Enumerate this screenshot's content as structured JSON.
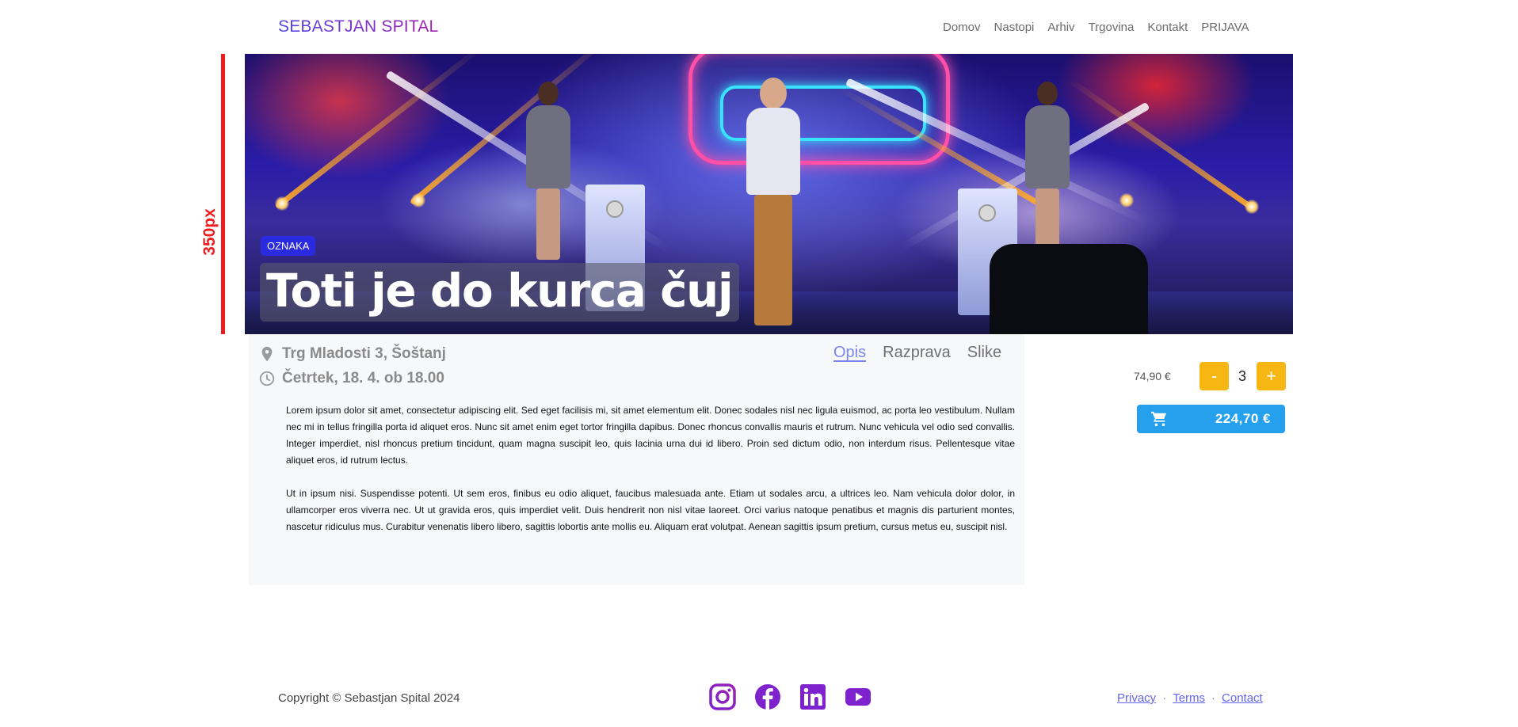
{
  "header": {
    "brand": "SEBASTJAN SPITAL",
    "nav": [
      "Domov",
      "Nastopi",
      "Arhiv",
      "Trgovina",
      "Kontakt",
      "PRIJAVA"
    ]
  },
  "annotation": {
    "label": "350px"
  },
  "hero": {
    "tag": "OZNAKA",
    "title": "Toti je do kurca čuj"
  },
  "details": {
    "location": "Trg Mladosti 3, Šoštanj",
    "datetime": "Četrtek, 18. 4. ob 18.00",
    "tabs": [
      {
        "label": "Opis",
        "active": true
      },
      {
        "label": "Razprava",
        "active": false
      },
      {
        "label": "Slike",
        "active": false
      }
    ],
    "paragraphs": [
      "Lorem ipsum dolor sit amet, consectetur adipiscing elit. Sed eget facilisis mi, sit amet elementum elit. Donec sodales nisl nec ligula euismod, ac porta leo vestibulum. Nullam nec mi in tellus fringilla porta id aliquet eros. Nunc sit amet enim eget tortor fringilla dapibus. Donec rhoncus convallis mauris et rutrum. Nunc vehicula vel odio sed convallis. Integer imperdiet, nisl rhoncus pretium tincidunt, quam magna suscipit leo, quis lacinia urna dui id libero. Proin sed dictum odio, non interdum risus. Pellentesque vitae aliquet eros, id rutrum lectus.",
      "Ut in ipsum nisi. Suspendisse potenti. Ut sem eros, finibus eu odio aliquet, faucibus malesuada ante. Etiam ut sodales arcu, a ultrices leo. Nam vehicula dolor dolor, in ullamcorper eros viverra nec. Ut ut gravida eros, quis imperdiet velit. Duis hendrerit non nisl vitae laoreet. Orci varius natoque penatibus et magnis dis parturient montes, nascetur ridiculus mus. Curabitur venenatis libero libero, sagittis lobortis ante mollis eu. Aliquam erat volutpat. Aenean sagittis ipsum pretium, cursus metus eu, suscipit nisl."
    ]
  },
  "purchase": {
    "unit_price": "74,90 €",
    "minus": "-",
    "plus": "+",
    "quantity": "3",
    "total": "224,70 €"
  },
  "footer": {
    "copyright": "Copyright © Sebastjan Spital 2024",
    "socials": [
      "instagram-icon",
      "facebook-icon",
      "linkedin-icon",
      "youtube-icon"
    ],
    "links": [
      "Privacy",
      "Terms",
      "Contact"
    ],
    "separator": "·"
  },
  "colors": {
    "accent_blue": "#24a0ed",
    "qty_yellow": "#f6b712",
    "brand_purple": "#7c3aed",
    "tag_blue": "#2a2ae0",
    "annotation_red": "#ee1c1c"
  }
}
